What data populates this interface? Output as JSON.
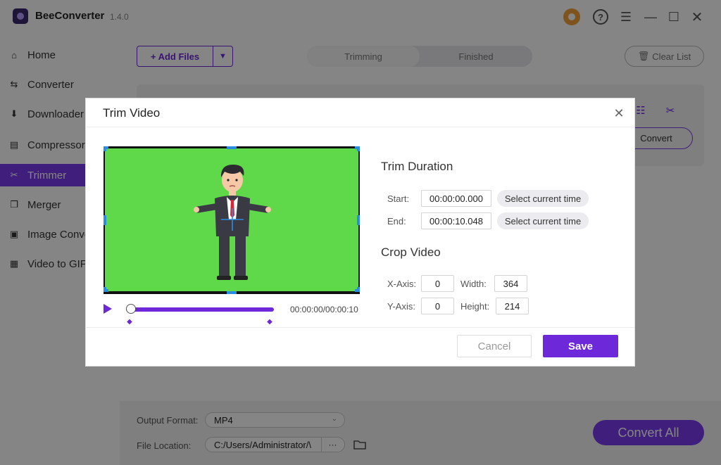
{
  "app": {
    "name": "BeeConverter",
    "version": "1.4.0"
  },
  "sidebar": {
    "items": [
      {
        "label": "Home",
        "icon": "home-icon"
      },
      {
        "label": "Converter",
        "icon": "swap-icon"
      },
      {
        "label": "Downloader",
        "icon": "download-icon"
      },
      {
        "label": "Compressor",
        "icon": "compress-icon"
      },
      {
        "label": "Trimmer",
        "icon": "scissors-icon",
        "active": true
      },
      {
        "label": "Merger",
        "icon": "merge-icon"
      },
      {
        "label": "Image Converter",
        "icon": "image-icon"
      },
      {
        "label": "Video to GIF",
        "icon": "gif-icon"
      }
    ]
  },
  "toolbar": {
    "add_files": "+ Add Files",
    "tabs": [
      "Trimming",
      "Finished"
    ],
    "clear_list": "Clear List"
  },
  "file_card": {
    "convert_label": "Convert"
  },
  "bottom": {
    "output_format_label": "Output Format:",
    "output_format_value": "MP4",
    "file_location_label": "File Location:",
    "file_location_value": "C:/Users/Administrator/\\",
    "more_label": "···",
    "convert_all": "Convert All"
  },
  "modal": {
    "title": "Trim Video",
    "timecode": "00:00:00/00:00:10",
    "trim_duration_title": "Trim Duration",
    "start_label": "Start:",
    "start_value": "00:00:00.000",
    "end_label": "End:",
    "end_value": "00:00:10.048",
    "select_current_time": "Select current time",
    "crop_video_title": "Crop Video",
    "x_axis_label": "X-Axis:",
    "x_axis_value": "0",
    "y_axis_label": "Y-Axis:",
    "y_axis_value": "0",
    "width_label": "Width:",
    "width_value": "364",
    "height_label": "Height:",
    "height_value": "214",
    "cancel": "Cancel",
    "save": "Save"
  },
  "colors": {
    "accent": "#6d28d9",
    "preview_bg": "#5fd84a"
  }
}
